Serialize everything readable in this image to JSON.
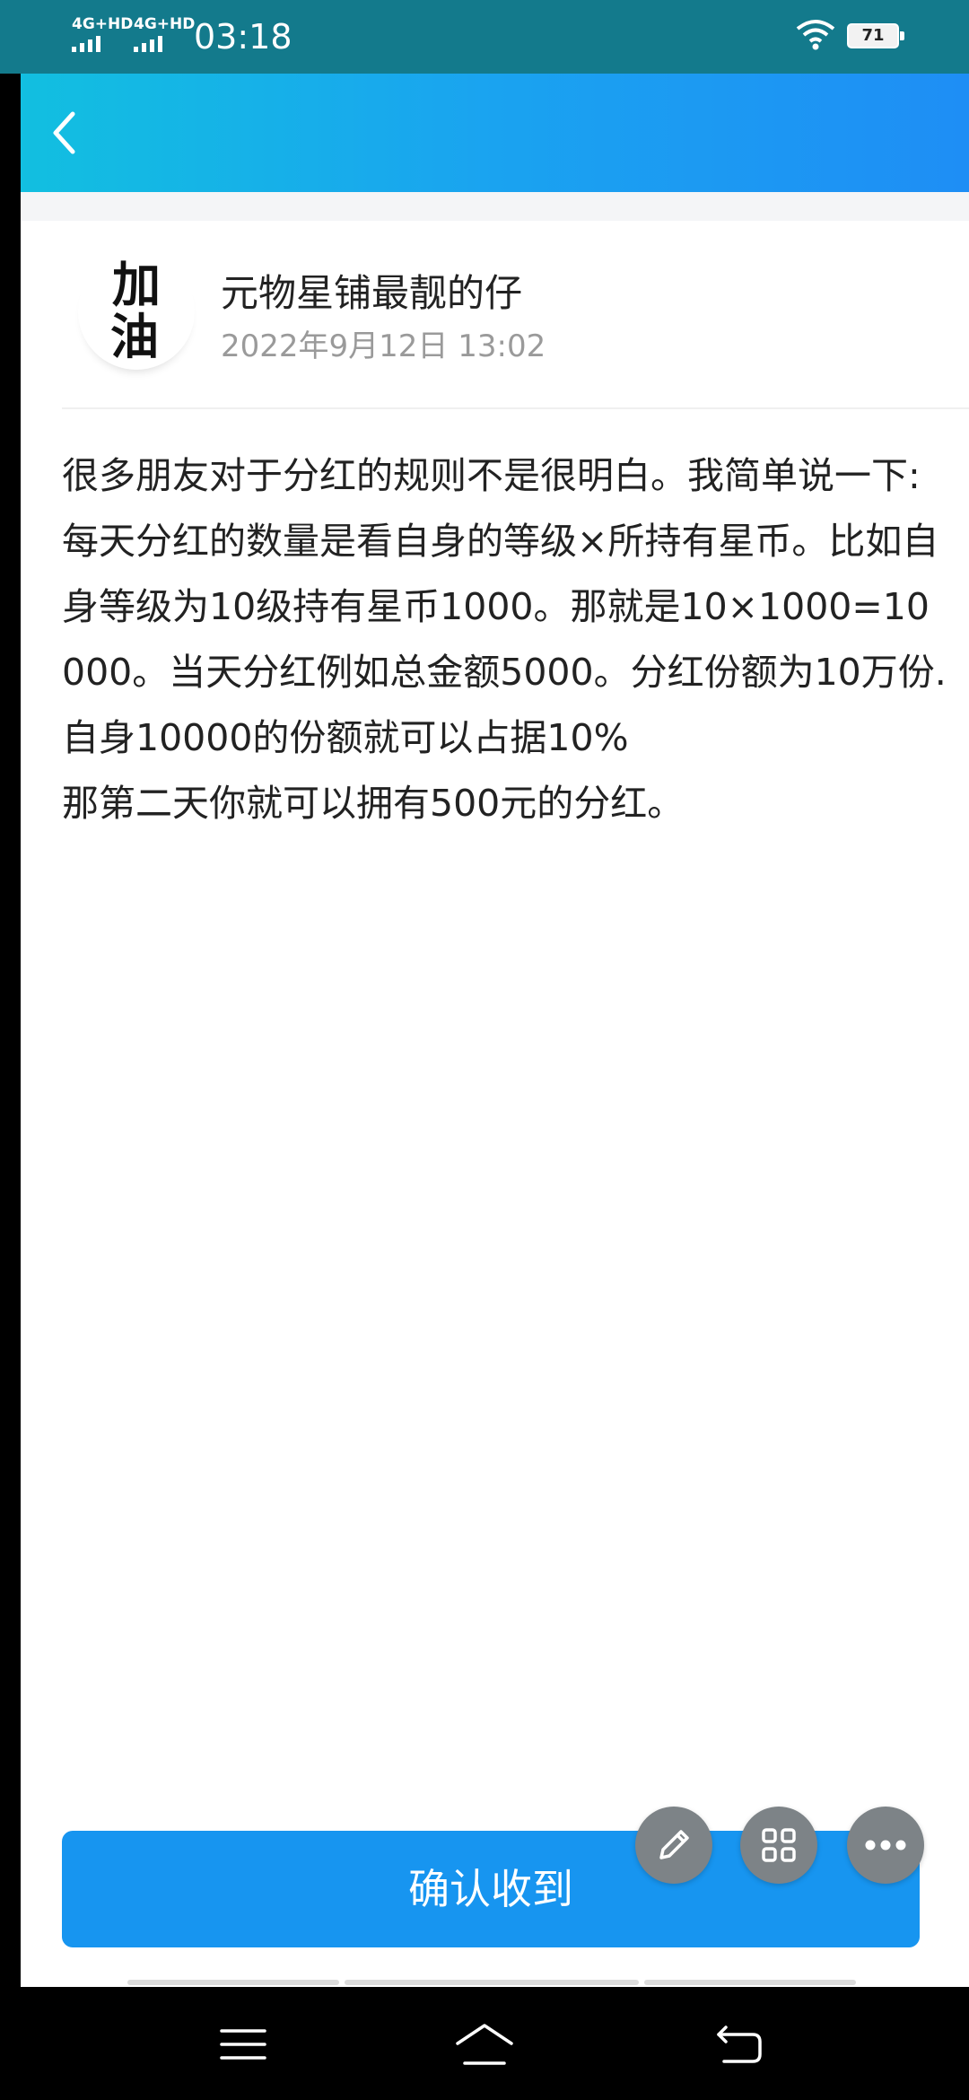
{
  "status_bar": {
    "signal_1": "4G+HD",
    "signal_2": "4G+HD",
    "time": "03:18",
    "battery": "71"
  },
  "header": {
    "back_icon": "chevron-left-icon"
  },
  "post": {
    "avatar_chars": [
      "加",
      "油"
    ],
    "author": "元物星铺最靓的仔",
    "date": "2022年9月12日 13:02",
    "body": "很多朋友对于分红的规则不是很明白。我简单说一下:每天分红的数量是看自身的等级×所持有星币。比如自身等级为10级持有星币1000。那就是10×1000=10000。当天分红例如总金额5000。分红份额为10万份.自身10000的份额就可以占据10%\n那第二天你就可以拥有500元的分红。"
  },
  "actions": {
    "confirm_label": "确认收到",
    "fab_icons": [
      "pencil-icon",
      "grid-icon",
      "more-icon"
    ]
  },
  "nav": {
    "icons": [
      "menu-icon",
      "home-icon",
      "back-icon"
    ]
  },
  "colors": {
    "status_bar": "#137a8c",
    "header_gradient_start": "#12bfe0",
    "header_gradient_end": "#1e8ef5",
    "button": "#1795f0",
    "fab": "#7d8387"
  }
}
